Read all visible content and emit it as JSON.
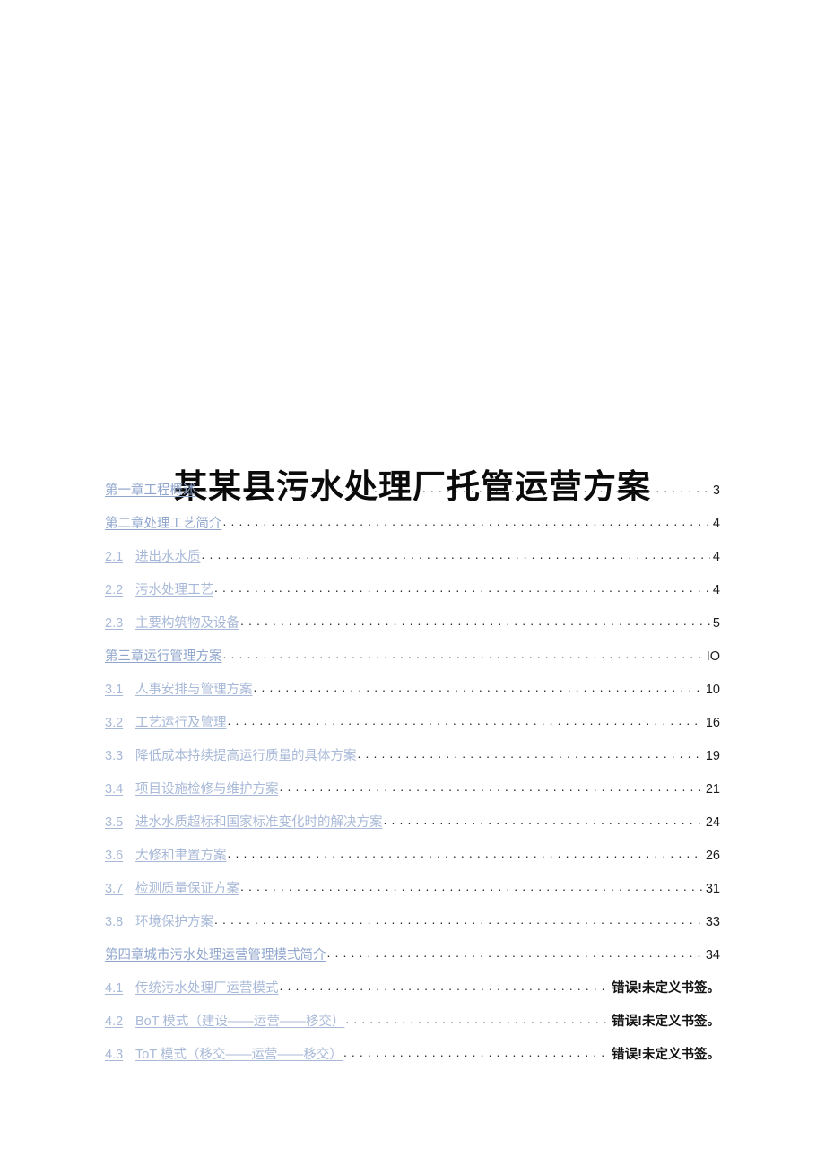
{
  "document": {
    "title": "某某县污水处理厂托管运营方案"
  },
  "toc": {
    "entries": [
      {
        "level": 1,
        "number": "",
        "label": "第一章工程概述",
        "page": "3",
        "bookmark_error": false
      },
      {
        "level": 1,
        "number": "",
        "label": "第二章处理工艺简介",
        "page": "4",
        "bookmark_error": false
      },
      {
        "level": 2,
        "number": "2.1",
        "label": "进出水水质",
        "page": "4",
        "bookmark_error": false
      },
      {
        "level": 2,
        "number": "2.2",
        "label": "污水处理工艺",
        "page": "4",
        "bookmark_error": false
      },
      {
        "level": 2,
        "number": "2.3",
        "label": "主要构筑物及设备",
        "page": "5",
        "bookmark_error": false
      },
      {
        "level": 1,
        "number": "",
        "label": "第三章运行管理方案",
        "page": "IO",
        "bookmark_error": false
      },
      {
        "level": 2,
        "number": "3.1",
        "label": "人事安排与管理方案",
        "page": "10",
        "bookmark_error": false
      },
      {
        "level": 2,
        "number": "3.2",
        "label": "工艺运行及管理",
        "page": "16",
        "bookmark_error": false
      },
      {
        "level": 2,
        "number": "3.3",
        "label": "降低成本持续提高运行质量的具体方案",
        "page": "19",
        "bookmark_error": false
      },
      {
        "level": 2,
        "number": "3.4",
        "label": "项目设施检修与维护方案",
        "page": "21",
        "bookmark_error": false
      },
      {
        "level": 2,
        "number": "3.5",
        "label": "进水水质超标和国家标准变化时的解决方案",
        "page": "24",
        "bookmark_error": false
      },
      {
        "level": 2,
        "number": "3.6",
        "label": "大修和聿置方案",
        "page": "26",
        "bookmark_error": false
      },
      {
        "level": 2,
        "number": "3.7",
        "label": "检测质量保证方案",
        "page": "31",
        "bookmark_error": false
      },
      {
        "level": 2,
        "number": "3.8",
        "label": "环境保护方案",
        "page": "33",
        "bookmark_error": false
      },
      {
        "level": 1,
        "number": "",
        "label": "第四章城市污水处理运营管理模式简介",
        "page": "34",
        "bookmark_error": false
      },
      {
        "level": 2,
        "number": "4.1",
        "label": "传统污水处理厂运营模式",
        "page": "错误!未定义书签。",
        "bookmark_error": true
      },
      {
        "level": 2,
        "number": "4.2",
        "label": "BoT 模式（建设——运营——移交）",
        "page": "错误!未定义书签。",
        "bookmark_error": true
      },
      {
        "level": 2,
        "number": "4.3",
        "label": "ToT 模式（移交——运营——移交）",
        "page": "错误!未定义书签。",
        "bookmark_error": true
      }
    ]
  },
  "colors": {
    "level1_link": "#8fa5cc",
    "level2_link": "#a8b9d8",
    "title": "#0b0b0b",
    "page_number": "#1a1a1a",
    "leader": "#2b2b2b",
    "background": "#ffffff"
  }
}
